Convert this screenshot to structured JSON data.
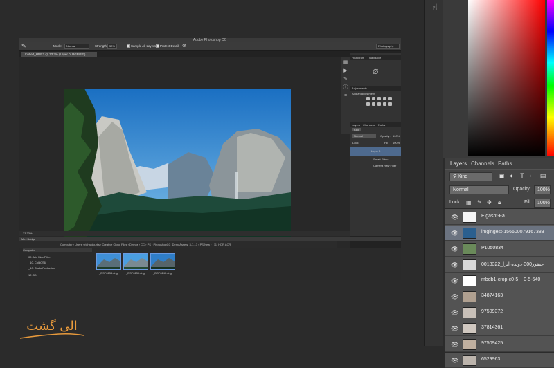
{
  "inner_window": {
    "title": "Adobe Photoshop CC",
    "options_bar": {
      "mode_label": "Mode:",
      "mode_value": "Normal",
      "strength_label": "Strength:",
      "strength_value": "50%",
      "sample_all_layers": "Sample All Layers",
      "protect_detail": "Protect Detail",
      "workspace": "Photography"
    },
    "doc_tab": "Untitled_HDR2 @ 33.3% (Layer 0, RGB/32*)",
    "zoom": "33.33%",
    "panels": {
      "histogram_tab": "Histogram",
      "navigator_tab": "Navigator",
      "adjustments_tab": "Adjustments",
      "add_adjustment": "Add an adjustment",
      "layers_tab": "Layers",
      "channels_tab": "Channels",
      "paths_tab": "Paths",
      "kind": "Kind",
      "blend": "Normal",
      "opacity_label": "Opacity:",
      "opacity_value": "100%",
      "lock_label": "Lock:",
      "fill_label": "Fill:",
      "fill_value": "100%",
      "layer_name": "Layer 0",
      "smart_filters": "Smart Filters",
      "camera_raw_filter": "Camera Raw Filter"
    },
    "mini_bridge": {
      "title": "Mini Bridge",
      "path": "Computer › Users › richardcurtis › Creative Cloud Files › Demos › CC › PS › PhotoshopCC_DemoAssets_3-7-13 › PS New › _11. HDR ACR",
      "tree": [
        "Computer",
        "09. Min Max Filter",
        "_10. ColdCS6",
        "_10. ShakeReduction",
        "12. 3D"
      ],
      "thumbs": [
        "_DSF6238.dng",
        "_DSF6239.dng",
        "_DSF6240.dng"
      ]
    }
  },
  "layers_panel": {
    "tabs": [
      "Layers",
      "Channels",
      "Paths"
    ],
    "kind": "Kind",
    "blend_mode": "Normal",
    "opacity_label": "Opacity:",
    "opacity_value": "100%",
    "lock_label": "Lock:",
    "fill_label": "Fill:",
    "fill_value": "100%",
    "layers": [
      {
        "name": "Elgasht-Fa",
        "selected": false
      },
      {
        "name": "imgingest-156600079167383",
        "selected": true
      },
      {
        "name": "P1050834",
        "selected": false
      },
      {
        "name": "0018322_حضور300-دونده-ایرا",
        "selected": false
      },
      {
        "name": "mbdb1-crop-c0-5__0-5-640",
        "selected": false
      },
      {
        "name": "34874163",
        "selected": false
      },
      {
        "name": "97509372",
        "selected": false
      },
      {
        "name": "37814361",
        "selected": false
      },
      {
        "name": "97509425",
        "selected": false
      },
      {
        "name": "6529963",
        "selected": false
      }
    ]
  },
  "watermark": {
    "text": "الی گشت"
  },
  "colors": {
    "accent": "#6b7380",
    "panel": "#535353",
    "background": "#2b2b2b"
  }
}
